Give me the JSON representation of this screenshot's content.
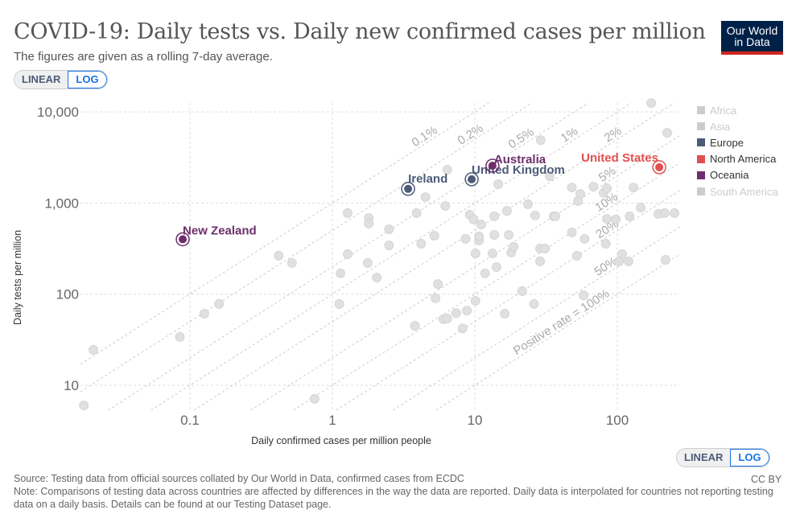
{
  "header": {
    "title": "COVID-19: Daily tests vs. Daily new confirmed cases per million",
    "subtitle": "The figures are given as a rolling 7-day average.",
    "logo": "Our World in Data"
  },
  "toggle": {
    "linear": "LINEAR",
    "log": "LOG",
    "selected": "LOG"
  },
  "legend": [
    {
      "label": "Africa",
      "color": "#cccccc",
      "active": false
    },
    {
      "label": "Asia",
      "color": "#cccccc",
      "active": false
    },
    {
      "label": "Europe",
      "color": "#4c5c78",
      "active": true
    },
    {
      "label": "North America",
      "color": "#e0504f",
      "active": true
    },
    {
      "label": "Oceania",
      "color": "#6d2e6b",
      "active": true
    },
    {
      "label": "South America",
      "color": "#cccccc",
      "active": false
    }
  ],
  "footer": {
    "source": "Source: Testing data from official sources collated by Our World in Data, confirmed cases from ECDC",
    "note": "Note: Comparisons of testing data across countries are affected by differences in the way the data are reported. Daily data is interpolated for countries not reporting testing data on a daily basis. Details can be found at our Testing Dataset page.",
    "license": "CC BY"
  },
  "chart_data": {
    "type": "scatter",
    "title": "COVID-19: Daily tests vs. Daily new confirmed cases per million",
    "xlabel": "Daily confirmed cases per million people",
    "ylabel": "Daily tests per million",
    "xscale": "log",
    "yscale": "log",
    "xlim": [
      0.017,
      275
    ],
    "ylim": [
      5.4,
      12600
    ],
    "xticks": [
      {
        "v": 0.1,
        "label": "0.1"
      },
      {
        "v": 1,
        "label": "1"
      },
      {
        "v": 10,
        "label": "10"
      },
      {
        "v": 100,
        "label": "100"
      }
    ],
    "yticks": [
      {
        "v": 10,
        "label": "10"
      },
      {
        "v": 100,
        "label": "100"
      },
      {
        "v": 1000,
        "label": "1,000"
      },
      {
        "v": 10000,
        "label": "10,000"
      }
    ],
    "grid": true,
    "legend_position": "right",
    "reference_lines": [
      {
        "rate": 0.001,
        "label": "0.1%"
      },
      {
        "rate": 0.002,
        "label": "0.2%"
      },
      {
        "rate": 0.005,
        "label": "0.5%"
      },
      {
        "rate": 0.01,
        "label": "1%"
      },
      {
        "rate": 0.02,
        "label": "2%"
      },
      {
        "rate": 0.05,
        "label": "5%"
      },
      {
        "rate": 0.1,
        "label": "10%"
      },
      {
        "rate": 0.2,
        "label": "20%"
      },
      {
        "rate": 0.5,
        "label": "50%"
      },
      {
        "rate": 1,
        "label": "Positive rate = 100%"
      }
    ],
    "highlighted": [
      {
        "name": "New Zealand",
        "continent": "Oceania",
        "x": 0.089,
        "y": 400,
        "color": "#6d2e6b"
      },
      {
        "name": "Ireland",
        "continent": "Europe",
        "x": 3.4,
        "y": 1430,
        "color": "#4c5c78"
      },
      {
        "name": "United Kingdom",
        "continent": "Europe",
        "x": 9.5,
        "y": 1820,
        "color": "#4c5c78"
      },
      {
        "name": "Australia",
        "continent": "Oceania",
        "x": 13.3,
        "y": 2570,
        "color": "#6d2e6b"
      },
      {
        "name": "United States",
        "continent": "North America",
        "x": 197,
        "y": 2470,
        "color": "#e0504f"
      }
    ],
    "other_points": [
      [
        0.018,
        6.0
      ],
      [
        0.021,
        24.5
      ],
      [
        0.085,
        34
      ],
      [
        0.126,
        61
      ],
      [
        0.16,
        78
      ],
      [
        0.42,
        264
      ],
      [
        0.52,
        220
      ],
      [
        0.75,
        7.1
      ],
      [
        1.12,
        78
      ],
      [
        1.14,
        169
      ],
      [
        1.28,
        775
      ],
      [
        1.28,
        275
      ],
      [
        1.77,
        220
      ],
      [
        1.8,
        685
      ],
      [
        1.8,
        595
      ],
      [
        2.05,
        152
      ],
      [
        2.5,
        343
      ],
      [
        2.5,
        515
      ],
      [
        3.8,
        45
      ],
      [
        3.9,
        775
      ],
      [
        4.2,
        357
      ],
      [
        4.5,
        1160
      ],
      [
        5.2,
        438
      ],
      [
        6.0,
        53
      ],
      [
        5.3,
        90
      ],
      [
        5.5,
        129
      ],
      [
        6.2,
        930
      ],
      [
        6.4,
        54
      ],
      [
        6.4,
        2320
      ],
      [
        7.4,
        62
      ],
      [
        8.2,
        42
      ],
      [
        8.6,
        404
      ],
      [
        8.8,
        66
      ],
      [
        9.2,
        745
      ],
      [
        10.1,
        84.5
      ],
      [
        10.1,
        280
      ],
      [
        9.8,
        660
      ],
      [
        10.7,
        388
      ],
      [
        10.7,
        430
      ],
      [
        11.1,
        580
      ],
      [
        11.8,
        169
      ],
      [
        13.3,
        280
      ],
      [
        13.7,
        447
      ],
      [
        14.6,
        1610
      ],
      [
        13.7,
        715
      ],
      [
        14.2,
        198
      ],
      [
        16.2,
        61
      ],
      [
        16.8,
        820
      ],
      [
        17.3,
        447
      ],
      [
        18,
        286
      ],
      [
        18.7,
        330
      ],
      [
        21.5,
        108
      ],
      [
        23.6,
        970
      ],
      [
        26,
        78
      ],
      [
        26.5,
        730
      ],
      [
        28.7,
        229
      ],
      [
        28.7,
        316
      ],
      [
        29,
        4900
      ],
      [
        31,
        316
      ],
      [
        33.5,
        1970
      ],
      [
        35.8,
        715
      ],
      [
        36.7,
        715
      ],
      [
        48,
        1480
      ],
      [
        48,
        475
      ],
      [
        52,
        264
      ],
      [
        53,
        1050
      ],
      [
        55,
        1260
      ],
      [
        58,
        97
      ],
      [
        59,
        404
      ],
      [
        68,
        1510
      ],
      [
        80,
        1290
      ],
      [
        84.5,
        1450
      ],
      [
        84.5,
        670
      ],
      [
        83,
        357
      ],
      [
        97.5,
        660
      ],
      [
        108,
        275
      ],
      [
        103,
        229
      ],
      [
        120,
        229
      ],
      [
        122,
        715
      ],
      [
        130,
        1480
      ],
      [
        146,
        890
      ],
      [
        173,
        12500
      ],
      [
        194,
        760
      ],
      [
        215,
        775
      ],
      [
        218,
        238
      ],
      [
        224,
        5900
      ],
      [
        252,
        775
      ]
    ]
  }
}
